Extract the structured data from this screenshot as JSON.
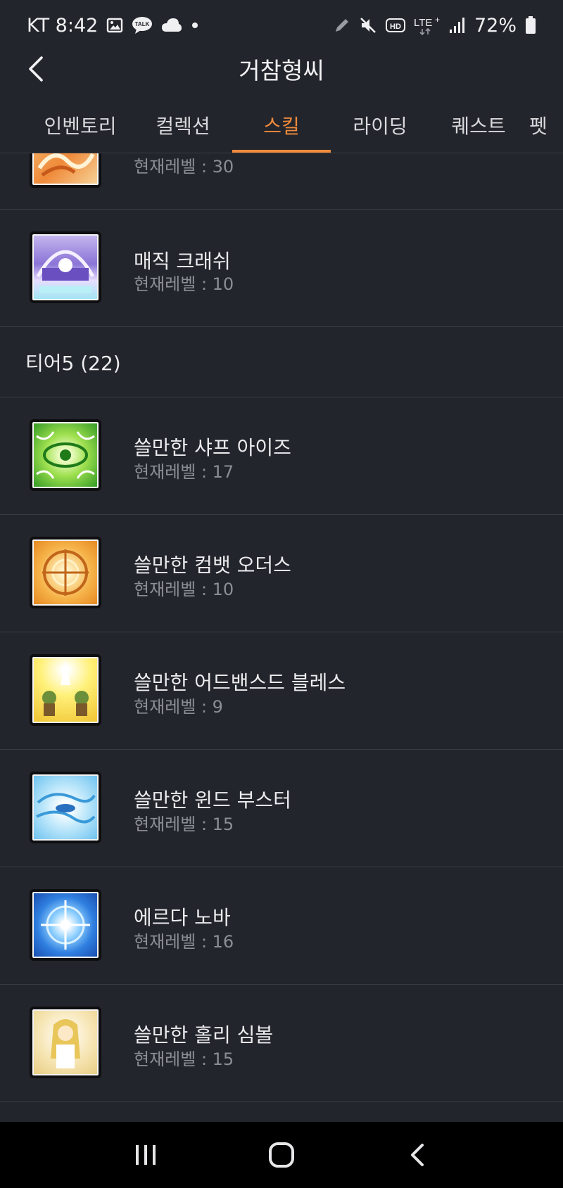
{
  "status_bar": {
    "carrier_time": "KT 8:42",
    "battery": "72%",
    "left_icons": [
      "gallery-icon",
      "kakaotalk-icon",
      "cloud-icon",
      "dot-icon"
    ],
    "right_icons": [
      "pen-icon",
      "mute-icon",
      "hd-icon",
      "lte-icon",
      "signal-icon",
      "battery-icon"
    ]
  },
  "header": {
    "title": "거참형씨"
  },
  "tabs": [
    {
      "label": "인벤토리",
      "active": false
    },
    {
      "label": "컬렉션",
      "active": false
    },
    {
      "label": "스킬",
      "active": true
    },
    {
      "label": "라이딩",
      "active": false
    },
    {
      "label": "퀘스트",
      "active": false
    },
    {
      "label": "펫",
      "active": false
    }
  ],
  "skills_top": [
    {
      "name": "",
      "level": "현재레벨 : 30"
    },
    {
      "name": "매직 크래쉬",
      "level": "현재레벨 : 10"
    }
  ],
  "section": {
    "title": "티어5 (22)"
  },
  "skills": [
    {
      "name": "쓸만한 샤프 아이즈",
      "level": "현재레벨 : 17"
    },
    {
      "name": "쓸만한 컴뱃 오더스",
      "level": "현재레벨 : 10"
    },
    {
      "name": "쓸만한 어드밴스드 블레스",
      "level": "현재레벨 : 9"
    },
    {
      "name": "쓸만한 윈드 부스터",
      "level": "현재레벨 : 15"
    },
    {
      "name": "에르다 노바",
      "level": "현재레벨 : 16"
    },
    {
      "name": "쓸만한 홀리 심볼",
      "level": "현재레벨 : 15"
    }
  ],
  "colors": {
    "background": "#23252c",
    "accent": "#f08a3c",
    "divider": "#3a3c44",
    "secondary_text": "#8c8e96"
  }
}
